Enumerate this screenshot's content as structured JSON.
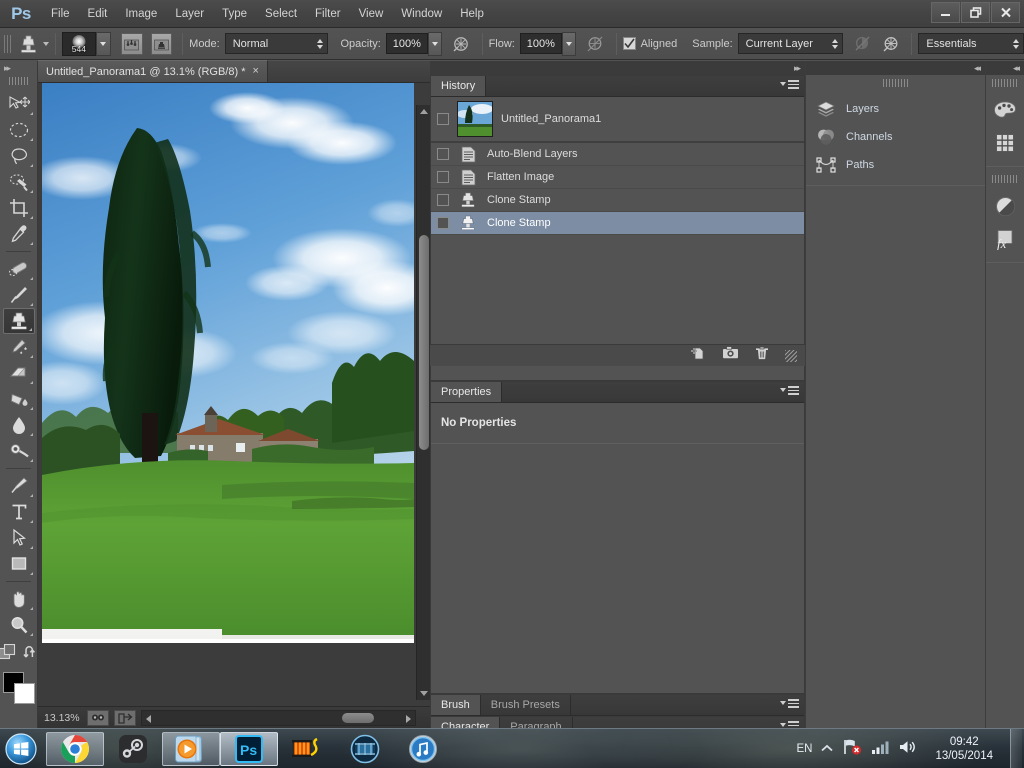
{
  "app": {
    "name": "Adobe Photoshop",
    "logo_text": "Ps"
  },
  "menubar": {
    "items": [
      {
        "label": "File"
      },
      {
        "label": "Edit"
      },
      {
        "label": "Image"
      },
      {
        "label": "Layer"
      },
      {
        "label": "Type"
      },
      {
        "label": "Select"
      },
      {
        "label": "Filter"
      },
      {
        "label": "View"
      },
      {
        "label": "Window"
      },
      {
        "label": "Help"
      }
    ]
  },
  "window_controls": {
    "minimize": "minimize-icon",
    "restore": "restore-icon",
    "close": "close-icon"
  },
  "options_bar": {
    "tool_icon": "clone-stamp-icon",
    "brush_size": "544",
    "toggle_brush_panel": "brush-panel-icon",
    "toggle_clone_source": "clone-source-icon",
    "mode_label": "Mode:",
    "mode_value": "Normal",
    "opacity_label": "Opacity:",
    "opacity_value": "100%",
    "opacity_pressure_icon": "pressure-opacity-icon",
    "flow_label": "Flow:",
    "flow_value": "100%",
    "airbrush_icon": "airbrush-icon",
    "aligned_label": "Aligned",
    "aligned_checked": true,
    "sample_label": "Sample:",
    "sample_value": "Current Layer",
    "ignore_adjustment_icon": "ignore-adjustment-layers-icon",
    "pressure_size_icon": "pressure-size-icon",
    "workspace_value": "Essentials"
  },
  "toolbar": {
    "collapse_icon": "collapse-double-arrow-icon",
    "tools": [
      {
        "name": "move-tool",
        "selected": false
      },
      {
        "name": "elliptical-marquee-tool",
        "selected": false
      },
      {
        "name": "lasso-tool",
        "selected": false
      },
      {
        "name": "quick-selection-tool",
        "selected": false
      },
      {
        "name": "crop-tool",
        "selected": false
      },
      {
        "name": "eyedropper-tool",
        "selected": false
      },
      {
        "name": "spot-healing-brush-tool",
        "selected": false
      },
      {
        "name": "brush-tool",
        "selected": false
      },
      {
        "name": "clone-stamp-tool",
        "selected": true
      },
      {
        "name": "history-brush-tool",
        "selected": false
      },
      {
        "name": "eraser-tool",
        "selected": false
      },
      {
        "name": "gradient-tool",
        "selected": false
      },
      {
        "name": "blur-tool",
        "selected": false
      },
      {
        "name": "dodge-tool",
        "selected": false
      },
      {
        "name": "pen-tool",
        "selected": false
      },
      {
        "name": "horizontal-type-tool",
        "selected": false
      },
      {
        "name": "path-selection-tool",
        "selected": false
      },
      {
        "name": "rectangle-tool",
        "selected": false
      },
      {
        "name": "hand-tool",
        "selected": false
      },
      {
        "name": "zoom-tool",
        "selected": false
      }
    ],
    "quick_mask_icon": "quick-mask-icon",
    "swap_colors_icon": "swap-colors-icon",
    "foreground_color": "#000000",
    "background_color": "#ffffff"
  },
  "document": {
    "tab_title": "Untitled_Panorama1 @ 13.1% (RGB/8) *",
    "close_label": "×",
    "zoom_level": "13.13%",
    "status_btn_icon": "document-settings-icon",
    "share_btn_icon": "share-icon"
  },
  "history_panel": {
    "tab_label": "History",
    "menu_icon": "panel-menu-icon",
    "collapse_icon": "collapse-double-arrow-icon",
    "snapshot": {
      "label": "Untitled_Panorama1",
      "icon": "snapshot-thumbnail",
      "selected": false
    },
    "states": [
      {
        "label": "Auto-Blend Layers",
        "icon": "document-state-icon",
        "selected": false
      },
      {
        "label": "Flatten Image",
        "icon": "document-state-icon",
        "selected": false
      },
      {
        "label": "Clone Stamp",
        "icon": "clone-stamp-icon",
        "selected": false
      },
      {
        "label": "Clone Stamp",
        "icon": "clone-stamp-icon",
        "selected": true
      }
    ],
    "footer_buttons": [
      {
        "name": "create-document-from-state-icon"
      },
      {
        "name": "create-new-snapshot-icon"
      },
      {
        "name": "delete-state-icon"
      }
    ],
    "highlight_color": "#7d8da3"
  },
  "properties_panel": {
    "tab_label": "Properties",
    "empty_message": "No Properties",
    "menu_icon": "panel-menu-icon"
  },
  "brush_panel": {
    "tabs": [
      {
        "label": "Brush",
        "active": true
      },
      {
        "label": "Brush Presets",
        "active": false
      }
    ],
    "menu_icon": "panel-menu-icon"
  },
  "character_panel": {
    "tabs": [
      {
        "label": "Character",
        "active": true
      },
      {
        "label": "Paragraph",
        "active": false
      }
    ],
    "menu_icon": "panel-menu-icon"
  },
  "dock_primary": {
    "collapse_icon": "collapse-double-arrow-icon",
    "items": [
      {
        "label": "Layers",
        "icon": "layers-icon"
      },
      {
        "label": "Channels",
        "icon": "channels-icon"
      },
      {
        "label": "Paths",
        "icon": "paths-icon"
      }
    ]
  },
  "dock_secondary": {
    "collapse_icon": "collapse-double-arrow-icon",
    "groups": [
      {
        "items": [
          {
            "icon": "color-palette-icon"
          },
          {
            "icon": "swatches-grid-icon"
          }
        ]
      },
      {
        "items": [
          {
            "icon": "adjustments-icon"
          },
          {
            "icon": "layer-styles-fx-icon"
          }
        ]
      }
    ]
  },
  "taskbar": {
    "start_icon": "windows-start-orb",
    "items": [
      {
        "name": "google-chrome",
        "icon": "chrome-icon",
        "boxed": true,
        "active": false
      },
      {
        "name": "steam",
        "icon": "steam-icon",
        "boxed": false,
        "active": false
      },
      {
        "name": "windows-media-player",
        "icon": "media-player-icon",
        "boxed": true,
        "active": false
      },
      {
        "name": "adobe-photoshop",
        "icon": "photoshop-icon",
        "boxed": true,
        "active": true
      },
      {
        "name": "video-editor",
        "icon": "film-strip-icon",
        "boxed": false,
        "active": false
      },
      {
        "name": "media-center",
        "icon": "film-reel-icon",
        "boxed": false,
        "active": false
      },
      {
        "name": "itunes",
        "icon": "itunes-icon",
        "boxed": false,
        "active": false
      }
    ],
    "tray": {
      "language": "EN",
      "show_hidden_icon": "chevron-up-icon",
      "network_icon": "network-error-icon",
      "signal_icon": "signal-bars-icon",
      "volume_icon": "volume-icon"
    },
    "clock": {
      "time": "09:42",
      "date": "13/05/2014"
    }
  }
}
